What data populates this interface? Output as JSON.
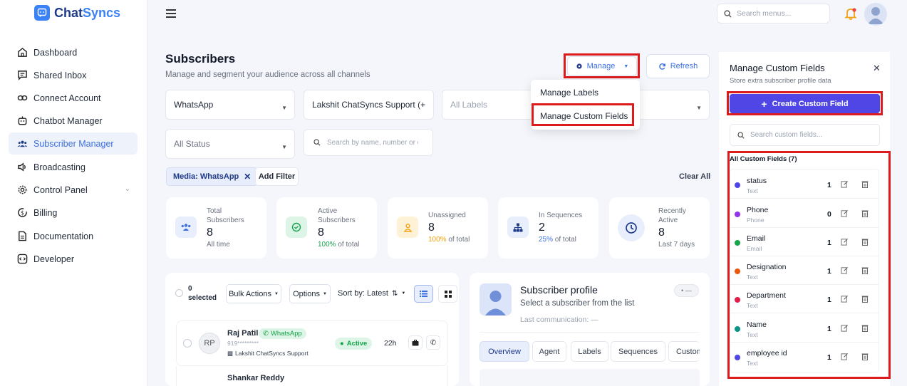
{
  "app": {
    "logo_text_1": "Chat",
    "logo_text_2": "Syncs"
  },
  "sidebar": {
    "items": [
      {
        "label": "Dashboard",
        "icon": "home-icon"
      },
      {
        "label": "Shared Inbox",
        "icon": "inbox-icon"
      },
      {
        "label": "Connect Account",
        "icon": "link-icon"
      },
      {
        "label": "Chatbot Manager",
        "icon": "bot-icon"
      },
      {
        "label": "Subscriber Manager",
        "icon": "users-icon",
        "active": true
      },
      {
        "label": "Broadcasting",
        "icon": "speaker-icon"
      },
      {
        "label": "Control Panel",
        "icon": "gear-icon"
      },
      {
        "label": "Billing",
        "icon": "billing-icon"
      },
      {
        "label": "Documentation",
        "icon": "document-icon"
      },
      {
        "label": "Developer",
        "icon": "code-icon"
      }
    ]
  },
  "topbar": {
    "search_placeholder": "Search menus..."
  },
  "header": {
    "title": "Subscribers",
    "subtitle": "Manage and segment your audience across all channels",
    "manage_label": "Manage",
    "refresh_label": "Refresh"
  },
  "manage_menu": {
    "item_1": "Manage Labels",
    "item_2": "Manage Custom Fields"
  },
  "filters": {
    "channel": "WhatsApp",
    "account": "Lakshit ChatSyncs Support (+→",
    "labels": "All Labels",
    "status": "All Status",
    "search_placeholder": "Search by name, number or email",
    "chip": "Media: WhatsApp",
    "add_filter": "Add Filter",
    "clear_all": "Clear All"
  },
  "stats": [
    {
      "label_1": "Total",
      "label_2": "Subscribers",
      "value": "8",
      "foot": "All time",
      "foot_accent": ""
    },
    {
      "label_1": "Active",
      "label_2": "Subscribers",
      "value": "8",
      "foot": "of total",
      "foot_accent": "100%"
    },
    {
      "label_1": "Unassigned",
      "label_2": "",
      "value": "8",
      "foot": "of total",
      "foot_accent": "100%"
    },
    {
      "label_1": "In Sequences",
      "label_2": "",
      "value": "2",
      "foot": "of total",
      "foot_accent": "25%"
    },
    {
      "label_1": "Recently",
      "label_2": "Active",
      "value": "8",
      "foot": "Last 7 days",
      "foot_accent": ""
    }
  ],
  "list": {
    "selected_count": "0",
    "selected_label": "selected",
    "bulk_actions": "Bulk Actions",
    "options": "Options",
    "sort_by": "Sort by: Latest",
    "rows": [
      {
        "initials": "RP",
        "name": "Raj Patil",
        "channel": "WhatsApp",
        "phone": "919*********",
        "account": "Lakshit ChatSyncs Support",
        "status": "Active",
        "time": "22h"
      },
      {
        "initials": "",
        "name": "Shankar Reddy",
        "channel": "",
        "phone": "",
        "account": "",
        "status": "",
        "time": ""
      }
    ]
  },
  "profile": {
    "title": "Subscriber profile",
    "subtitle": "Select a subscriber from the list",
    "last_comm": "Last communication: —",
    "toggle": "• —",
    "tabs": [
      "Overview",
      "Agent",
      "Labels",
      "Sequences",
      "Custom"
    ]
  },
  "drawer": {
    "title": "Manage Custom Fields",
    "subtitle": "Store extra subscriber profile data",
    "create_label": "Create Custom Field",
    "search_placeholder": "Search custom fields...",
    "list_header": "All Custom Fields (7)",
    "fields": [
      {
        "name": "status",
        "type": "Text",
        "count": "1",
        "color": "#4f46e5"
      },
      {
        "name": "Phone",
        "type": "Phone",
        "count": "0",
        "color": "#9333ea"
      },
      {
        "name": "Email",
        "type": "Email",
        "count": "1",
        "color": "#16a34a"
      },
      {
        "name": "Designation",
        "type": "Text",
        "count": "1",
        "color": "#ea580c"
      },
      {
        "name": "Department",
        "type": "Text",
        "count": "1",
        "color": "#e11d48"
      },
      {
        "name": "Name",
        "type": "Text",
        "count": "1",
        "color": "#0d9488"
      },
      {
        "name": "employee id",
        "type": "Text",
        "count": "1",
        "color": "#4f46e5"
      }
    ]
  },
  "colors": {
    "primary": "#4f46e5",
    "accent_blue": "#3b6fe0",
    "highlight": "#dc1c1c",
    "whatsapp": "#16a34a"
  }
}
